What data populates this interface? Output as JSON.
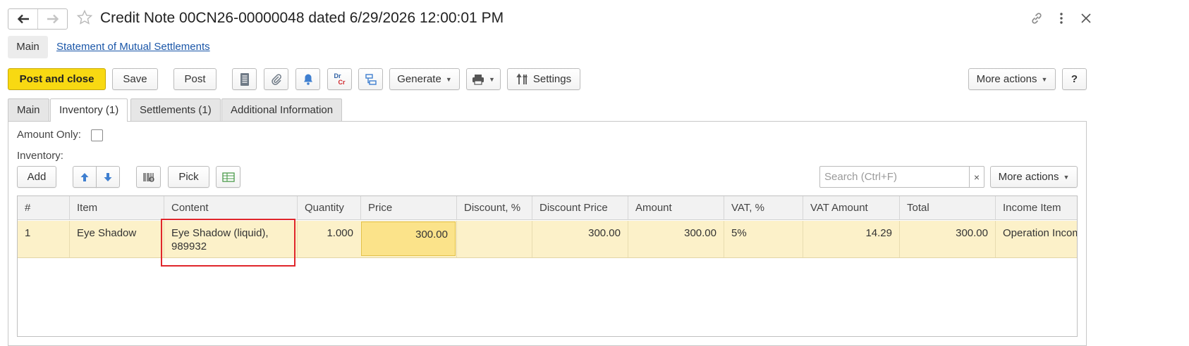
{
  "window": {
    "title": "Credit Note 00CN26-00000048 dated 6/29/2026 12:00:01 PM",
    "icons": [
      "arrow-left-icon",
      "arrow-right-icon",
      "star-icon",
      "link-icon",
      "kebab-menu-icon",
      "close-icon"
    ]
  },
  "sections": {
    "main": "Main",
    "link": "Statement of Mutual Settlements"
  },
  "toolbar": {
    "post_and_close": "Post and close",
    "save": "Save",
    "post": "Post",
    "generate": "Generate",
    "settings": "Settings",
    "more_actions": "More actions",
    "help": "?",
    "dr": "Dr",
    "cr": "Cr",
    "primary_color": "#f8d912"
  },
  "tabs": [
    {
      "label": "Main",
      "active": false
    },
    {
      "label": "Inventory (1)",
      "active": true
    },
    {
      "label": "Settlements (1)",
      "active": false
    },
    {
      "label": "Additional Information",
      "active": false
    }
  ],
  "form": {
    "amount_only_label": "Amount Only:",
    "amount_only_checked": false,
    "inventory_label": "Inventory:"
  },
  "inventory_toolbar": {
    "add": "Add",
    "pick": "Pick",
    "search_placeholder": "Search (Ctrl+F)",
    "clear": "×",
    "more_actions": "More actions"
  },
  "table": {
    "columns": [
      "#",
      "Item",
      "Content",
      "Quantity",
      "Price",
      "Discount, %",
      "Discount Price",
      "Amount",
      "VAT, %",
      "VAT Amount",
      "Total",
      "Income Item"
    ],
    "rows": [
      {
        "num": "1",
        "item": "Eye Shadow",
        "content": "Eye Shadow (liquid), 989932",
        "quantity": "1.000",
        "price": "300.00",
        "discount_pct": "",
        "discount_price": "300.00",
        "amount": "300.00",
        "vat_pct": "5%",
        "vat_amount": "14.29",
        "total": "300.00",
        "income_item": "Operation Income"
      }
    ]
  }
}
